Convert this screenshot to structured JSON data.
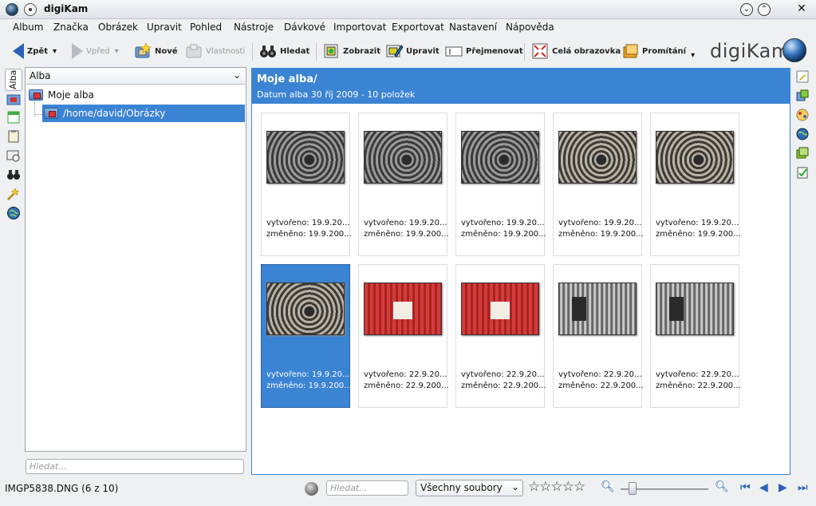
{
  "window": {
    "title": "digiKam",
    "min_glyph": "⌄",
    "max_glyph": "⌃",
    "close_glyph": "✕"
  },
  "menu": [
    {
      "label": "Album"
    },
    {
      "label": "Značka"
    },
    {
      "label": "Obrázek"
    },
    {
      "label": "Upravit"
    },
    {
      "label": "Pohled"
    },
    {
      "label": "Nástroje"
    },
    {
      "label": "Dávkové"
    },
    {
      "label": "Importovat"
    },
    {
      "label": "Exportovat"
    },
    {
      "label": "Nastavení"
    },
    {
      "label": "Nápověda"
    }
  ],
  "toolbar": {
    "back": "Zpět",
    "forward": "Vpřed",
    "new": "Nové",
    "properties": "Vlastnosti",
    "search": "Hledat",
    "view": "Zobrazit",
    "edit": "Upravit",
    "rename": "Přejmenovat",
    "fullscreen": "Celá obrazovka",
    "slideshow": "Promítání",
    "dropdown": "▾",
    "logo": "digiKam"
  },
  "left_tabs": {
    "albums_label": "Alba"
  },
  "album_panel": {
    "combo_label": "Alba",
    "combo_chev": "⌄",
    "root": "Moje alba",
    "child": "/home/david/Obrázky",
    "search_placeholder": "Hledat..."
  },
  "main": {
    "title": "Moje alba/",
    "subtitle": "Datum alba  30 říj 2009 - 10 položek",
    "thumbs": [
      {
        "line1": "vytvořeno: 19.9.20...",
        "line2": "změněno: 19.9.200...",
        "kind": "fan"
      },
      {
        "line1": "vytvořeno: 19.9.20...",
        "line2": "změněno: 19.9.200...",
        "kind": "fan"
      },
      {
        "line1": "vytvořeno: 19.9.20...",
        "line2": "změněno: 19.9.200...",
        "kind": "fan"
      },
      {
        "line1": "vytvořeno: 19.9.20...",
        "line2": "změněno: 19.9.200...",
        "kind": "fan-warm"
      },
      {
        "line1": "vytvořeno: 19.9.20...",
        "line2": "změněno: 19.9.200...",
        "kind": "fan-warm"
      },
      {
        "line1": "vytvořeno: 19.9.20...",
        "line2": "změněno: 19.9.200...",
        "kind": "fan-warm",
        "selected": true
      },
      {
        "line1": "vytvořeno: 22.9.20...",
        "line2": "změněno: 22.9.200...",
        "kind": "card"
      },
      {
        "line1": "vytvořeno: 22.9.20...",
        "line2": "změněno: 22.9.200...",
        "kind": "card"
      },
      {
        "line1": "vytvořeno: 22.9.20...",
        "line2": "změněno: 22.9.200...",
        "kind": "cooler"
      },
      {
        "line1": "vytvořeno: 22.9.20...",
        "line2": "změněno: 22.9.200...",
        "kind": "cooler"
      }
    ]
  },
  "status": {
    "text": "IMGP5838.DNG (6 z 10)",
    "search_placeholder": "Hledat...",
    "filter": "Všechny soubory",
    "filter_chev": "⌄",
    "stars": "☆☆☆☆☆",
    "zoom_out": "🔍︎",
    "zoom_in": "🔍︎",
    "nav_first": "⏮",
    "nav_prev": "◀",
    "nav_next": "▶",
    "nav_last": "⏭",
    "zoom_level": 0.1
  }
}
